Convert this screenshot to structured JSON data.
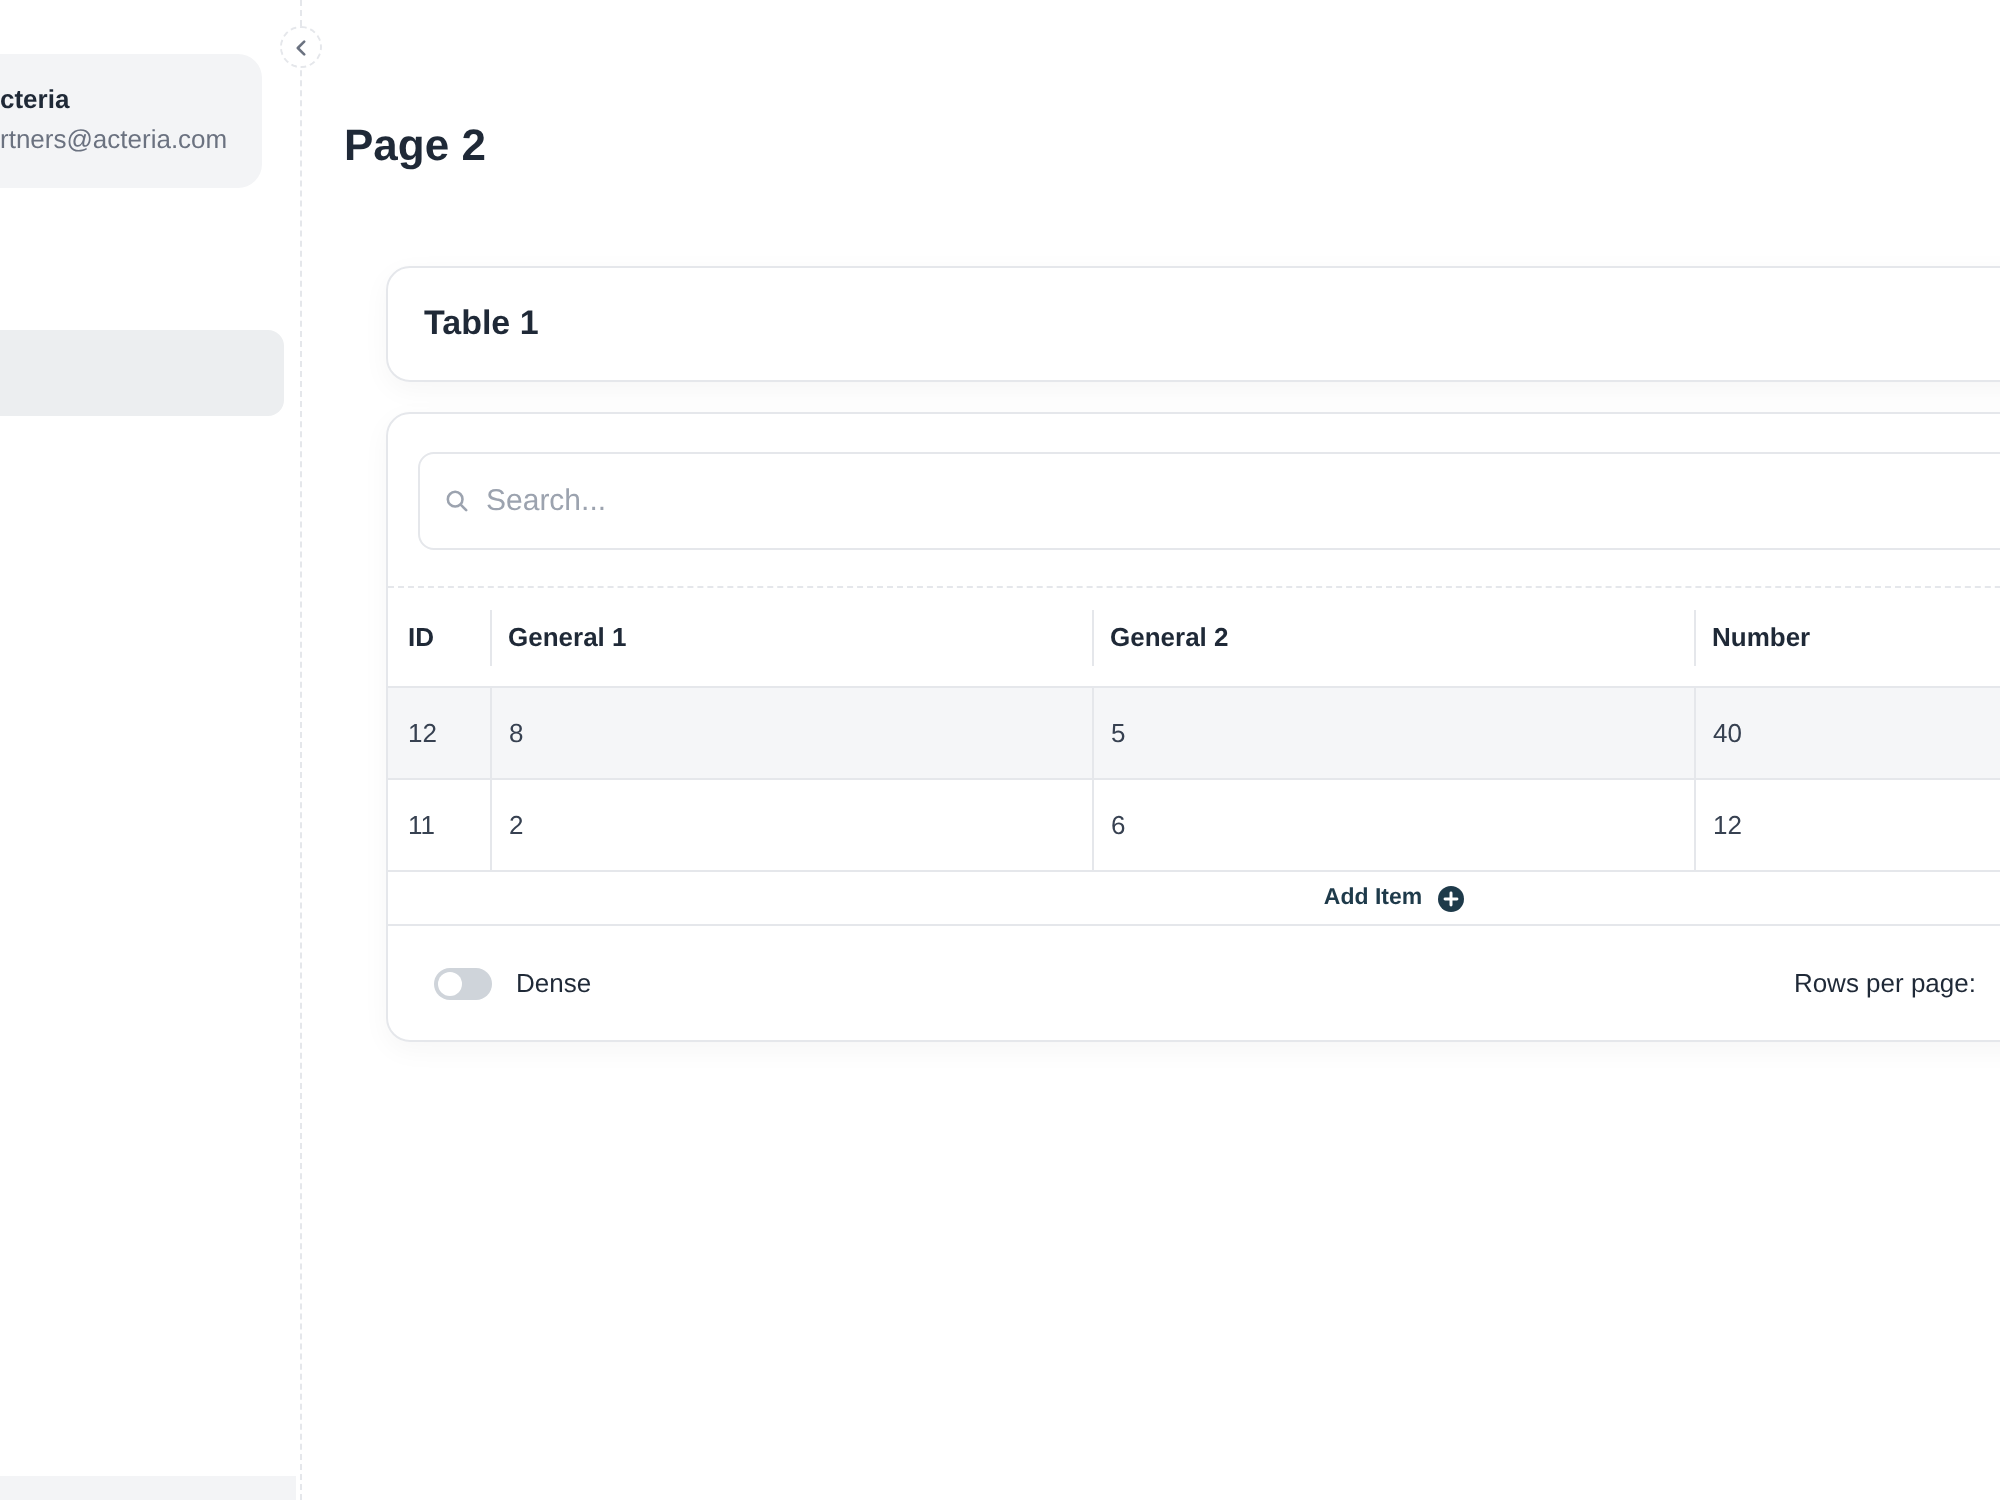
{
  "sidebar": {
    "account": {
      "name": "cteria",
      "email": "rtners@acteria.com"
    },
    "items": [
      {
        "selected": true
      }
    ]
  },
  "page": {
    "title": "Page 2"
  },
  "table_card": {
    "title": "Table 1"
  },
  "table": {
    "search": {
      "placeholder": "Search..."
    },
    "columns": [
      "ID",
      "General 1",
      "General 2",
      "Number"
    ],
    "rows": [
      [
        "12",
        "8",
        "5",
        "40"
      ],
      [
        "11",
        "2",
        "6",
        "12"
      ]
    ],
    "add_item": "Add Item",
    "dense_toggle": {
      "label": "Dense",
      "on": false
    },
    "rows_per_page": "Rows per page:"
  }
}
